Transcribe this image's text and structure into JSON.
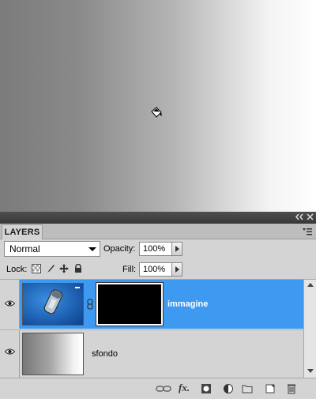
{
  "panel": {
    "tab_label": "LAYERS",
    "blend_mode": "Normal",
    "opacity_label": "Opacity:",
    "opacity_value": "100%",
    "lock_label": "Lock:",
    "fill_label": "Fill:",
    "fill_value": "100%"
  },
  "layers": [
    {
      "name": "immagine",
      "visible": true,
      "selected": true,
      "has_mask": true
    },
    {
      "name": "sfondo",
      "visible": true,
      "selected": false,
      "has_mask": false
    }
  ],
  "bottom_toolbar": {
    "fx_label": "fx.",
    "icons": [
      "link-layers-icon",
      "add-style-icon",
      "add-mask-icon",
      "adjustment-layer-icon",
      "new-group-icon",
      "new-layer-icon",
      "delete-layer-icon"
    ]
  },
  "colors": {
    "selection": "#3e9af0",
    "panel_bg": "#d4d4d4",
    "title_bar": "#3a3a3a"
  }
}
